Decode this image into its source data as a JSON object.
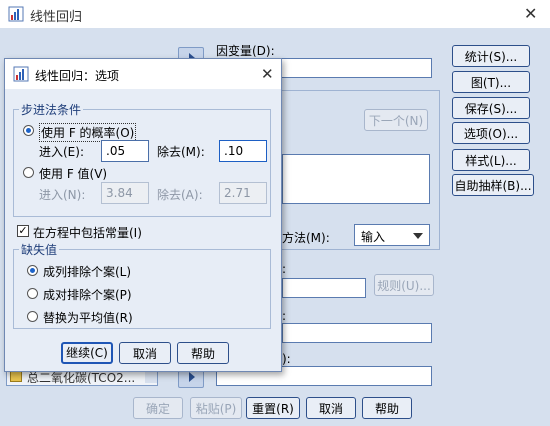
{
  "main": {
    "title": "线性回归",
    "dependent_label": "因变量(D):",
    "method_label": "方法(M):",
    "method_value": "输入",
    "next_button": "下一个(N)",
    "rule_button": "规则(U)...",
    "side_buttons": [
      "统计(S)...",
      "图(T)...",
      "保存(S)...",
      "选项(O)...",
      "样式(L)...",
      "自助抽样(B)..."
    ],
    "bottom_buttons": [
      "确定",
      "粘贴(P)",
      "重置(R)",
      "取消",
      "帮助"
    ],
    "variable_item": "总二氧化碳(TCO2..."
  },
  "dialog": {
    "title": "线性回归：选项",
    "stepping_group": "步进法条件",
    "use_prob_label": "使用 F 的概率(O)",
    "entry_label": "进入(E):",
    "entry_value": ".05",
    "removal_label": "除去(M):",
    "removal_value": ".10",
    "use_fvalue_label": "使用 F 值(V)",
    "entry_f_label": "进入(N):",
    "entry_f_value": "3.84",
    "removal_f_label": "除去(A):",
    "removal_f_value": "2.71",
    "include_constant_label": "在方程中包括常量(I)",
    "include_constant_checked": true,
    "missing_group": "缺失值",
    "missing_options": [
      "成列排除个案(L)",
      "成对排除个案(P)",
      "替换为平均值(R)"
    ],
    "selected_missing": 0,
    "buttons": [
      "继续(C)",
      "取消",
      "帮助"
    ]
  }
}
